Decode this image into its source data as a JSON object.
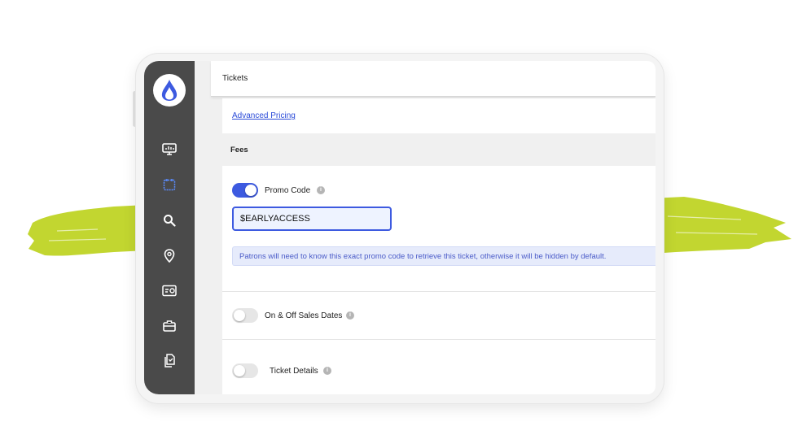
{
  "header": {
    "title": "Tickets"
  },
  "sidebar": {
    "items": [
      {
        "icon": "monitor-chart-icon",
        "active": false
      },
      {
        "icon": "calendar-icon",
        "active": true
      },
      {
        "icon": "search-icon",
        "active": false
      },
      {
        "icon": "location-pin-icon",
        "active": false
      },
      {
        "icon": "ticket-card-icon",
        "active": false
      },
      {
        "icon": "briefcase-icon",
        "active": false
      },
      {
        "icon": "documents-icon",
        "active": false
      }
    ]
  },
  "content": {
    "advanced_pricing_link": "Advanced Pricing",
    "fees_section_label": "Fees",
    "promo": {
      "label": "Promo Code",
      "enabled": true,
      "value": "$EARLYACCESS",
      "note": "Patrons will need to know this exact promo code to retrieve this ticket, otherwise it will be hidden by default."
    },
    "sales_dates": {
      "label": "On & Off Sales Dates",
      "enabled": false
    },
    "ticket_details": {
      "label": "Ticket Details",
      "enabled": false
    }
  },
  "colors": {
    "accent": "#3d5ae0",
    "sidebar_bg": "#4a4a4a",
    "brush": "#c2d630"
  }
}
